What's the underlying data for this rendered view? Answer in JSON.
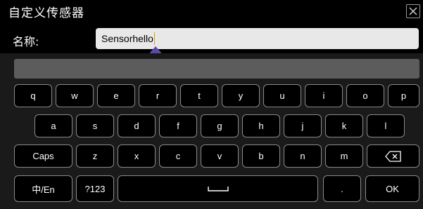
{
  "dialog": {
    "title": "自定义传感器",
    "close_icon": "close-icon"
  },
  "name_field": {
    "label": "名称:",
    "value": "Sensorhello"
  },
  "keyboard": {
    "row1": [
      "q",
      "w",
      "e",
      "r",
      "t",
      "y",
      "u",
      "i",
      "o",
      "p"
    ],
    "row2": [
      "a",
      "s",
      "d",
      "f",
      "g",
      "h",
      "j",
      "k",
      "l"
    ],
    "row3": {
      "caps_label": "Caps",
      "letters": [
        "z",
        "x",
        "c",
        "v",
        "b",
        "n",
        "m"
      ],
      "backspace_icon": "backspace-icon"
    },
    "row4": {
      "lang_label": "中/En",
      "symbols_label": "?123",
      "space_icon": "space-icon",
      "period_label": ".",
      "ok_label": "OK"
    }
  }
}
